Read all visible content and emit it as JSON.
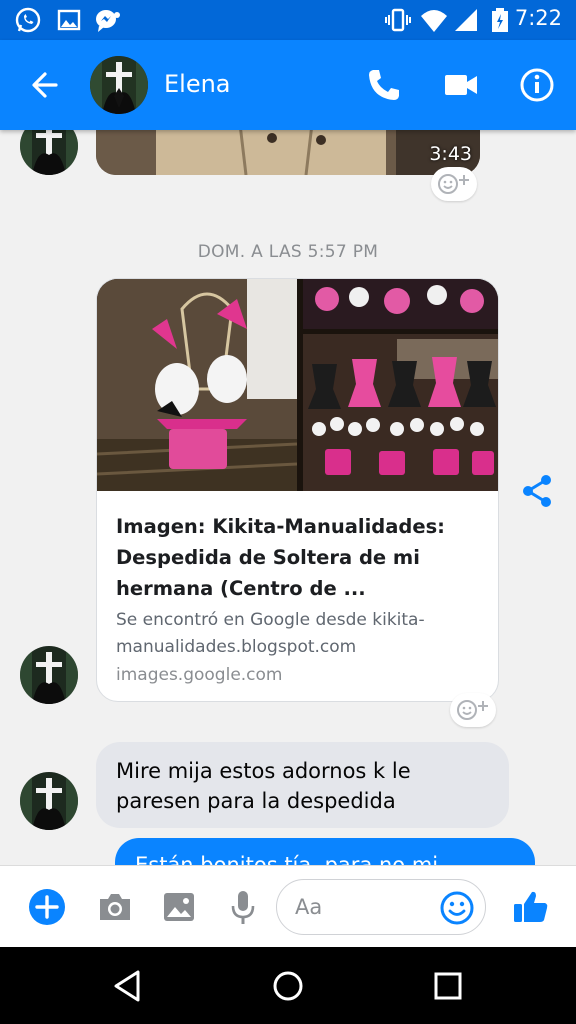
{
  "status_bar": {
    "time": "7:22",
    "left_icons": [
      "whatsapp-icon",
      "image-notification-icon",
      "messenger-notification-icon"
    ],
    "right_icons": [
      "vibrate-icon",
      "wifi-icon",
      "cell-signal-icon",
      "battery-icon"
    ]
  },
  "header": {
    "contact_name": "Elena",
    "actions": [
      "phone-icon",
      "video-call-icon",
      "info-icon"
    ]
  },
  "conversation": {
    "video_duration": "3:43",
    "timestamp": "DOM. A LAS 5:57 PM",
    "link_card": {
      "title": "Imagen: Kikita-Manualidades: Despedida de Soltera de mi hermana (Centro de ...",
      "found_text": "Se encontró en Google desde kikita-manualidades.blogspot.com",
      "domain": "images.google.com"
    },
    "incoming_message": "Mire mija estos adornos k le paresen para la despedida",
    "outgoing_message_partial": "Están bonitos tía, para no mi"
  },
  "composer": {
    "placeholder": "Aa",
    "buttons": [
      "add-icon",
      "camera-icon",
      "gallery-icon",
      "microphone-icon",
      "emoji-icon",
      "like-icon"
    ]
  },
  "colors": {
    "status_bar": "#0268d8",
    "app_bar": "#0a84ff",
    "accent": "#0a84ff",
    "incoming_bubble": "#e4e6eb"
  }
}
